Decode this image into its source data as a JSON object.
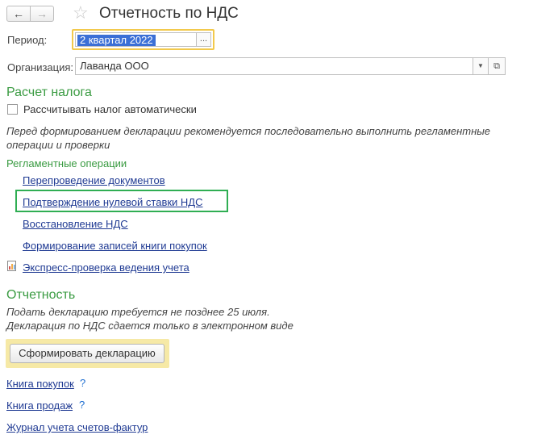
{
  "header": {
    "title": "Отчетность по НДС",
    "back_icon": "←",
    "forward_icon": "→",
    "star_icon": "☆"
  },
  "form": {
    "period_label": "Период:",
    "period_value": "2 квартал 2022",
    "period_select_icon": "...",
    "org_label": "Организация:",
    "org_value": "Лаванда ООО",
    "org_dropdown_icon": "▼",
    "org_open_icon": "⧉"
  },
  "tax": {
    "heading": "Расчет налога",
    "auto_calc_label": "Рассчитывать налог автоматически",
    "auto_calc_checked": false,
    "hint_line1": "Перед формированием декларации рекомендуется последовательно выполнить регламентные",
    "hint_line2": "операции и проверки",
    "ops_heading": "Регламентные операции",
    "ops": [
      "Перепроведение документов",
      "Подтверждение нулевой ставки НДС",
      "Восстановление НДС",
      "Формирование записей книги покупок"
    ],
    "express_check": "Экспресс-проверка ведения учета"
  },
  "reporting": {
    "heading": "Отчетность",
    "note_line1": "Подать декларацию требуется не позднее 25 июля.",
    "note_line2": "Декларация по НДС сдается только в электронном виде",
    "form_button": "Сформировать декларацию",
    "links": [
      {
        "label": "Книга покупок",
        "help": "?"
      },
      {
        "label": "Книга продаж",
        "help": "?"
      },
      {
        "label": "Журнал учета счетов-фактур",
        "help": ""
      }
    ]
  },
  "colors": {
    "section_green": "#3a9b42",
    "link_blue": "#1f3a93",
    "highlight_yellow": "#f2c94c",
    "highlight_green": "#2fae53",
    "selection_blue": "#3b6fd6"
  }
}
